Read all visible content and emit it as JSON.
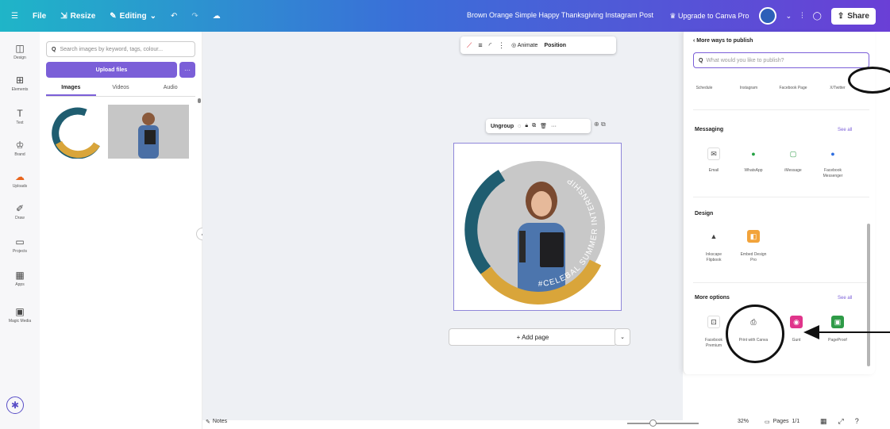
{
  "topbar": {
    "file": "File",
    "resize": "Resize",
    "editing": "Editing",
    "document_title": "Brown Orange Simple Happy Thanksgiving Instagram Post",
    "upgrade": "Upgrade to Canva Pro",
    "share": "Share"
  },
  "rail": {
    "items": [
      "Design",
      "Elements",
      "Text",
      "Brand",
      "Uploads",
      "Draw",
      "Projects",
      "Apps",
      "Magic Media"
    ]
  },
  "uploads_panel": {
    "search_placeholder": "Search images by keyword, tags, colour...",
    "upload_button": "Upload files",
    "tabs": [
      "Images",
      "Videos",
      "Audio"
    ]
  },
  "canvas": {
    "toolbar": {
      "animate": "Animate",
      "position": "Position"
    },
    "float_toolbar": {
      "ungroup": "Ungroup"
    },
    "design_text": "#CELEBAL SUMMER INTERNSHIP",
    "add_page": "+ Add page"
  },
  "publish_panel": {
    "header": "More ways to publish",
    "search_placeholder": "What would you like to publish?",
    "top_row_labels": [
      "Schedule",
      "Instagram",
      "Facebook Page",
      "X/Twitter"
    ],
    "sections": {
      "messaging": {
        "title": "Messaging",
        "see_all": "See all",
        "items": [
          "Email",
          "WhatsApp",
          "iMessage",
          "Facebook Messenger"
        ]
      },
      "design": {
        "title": "Design",
        "items": [
          "Inkscape Flipbook",
          "Embed Design Pro"
        ]
      },
      "more_options": {
        "title": "More options",
        "see_all": "See all",
        "items": [
          "Facebook Premium",
          "Print with Canva",
          "Gunt",
          "PageProof"
        ]
      }
    }
  },
  "bottom_bar": {
    "notes": "Notes",
    "zoom": "32%",
    "pages": "Pages",
    "page_count": "1/1",
    "zoom_level": 0.35
  },
  "colors": {
    "brand_purple": "#7b5fd8",
    "topbar_start": "#1fb5c8",
    "topbar_end": "#6a3fd6",
    "canvas_bg": "#eef0f4"
  }
}
